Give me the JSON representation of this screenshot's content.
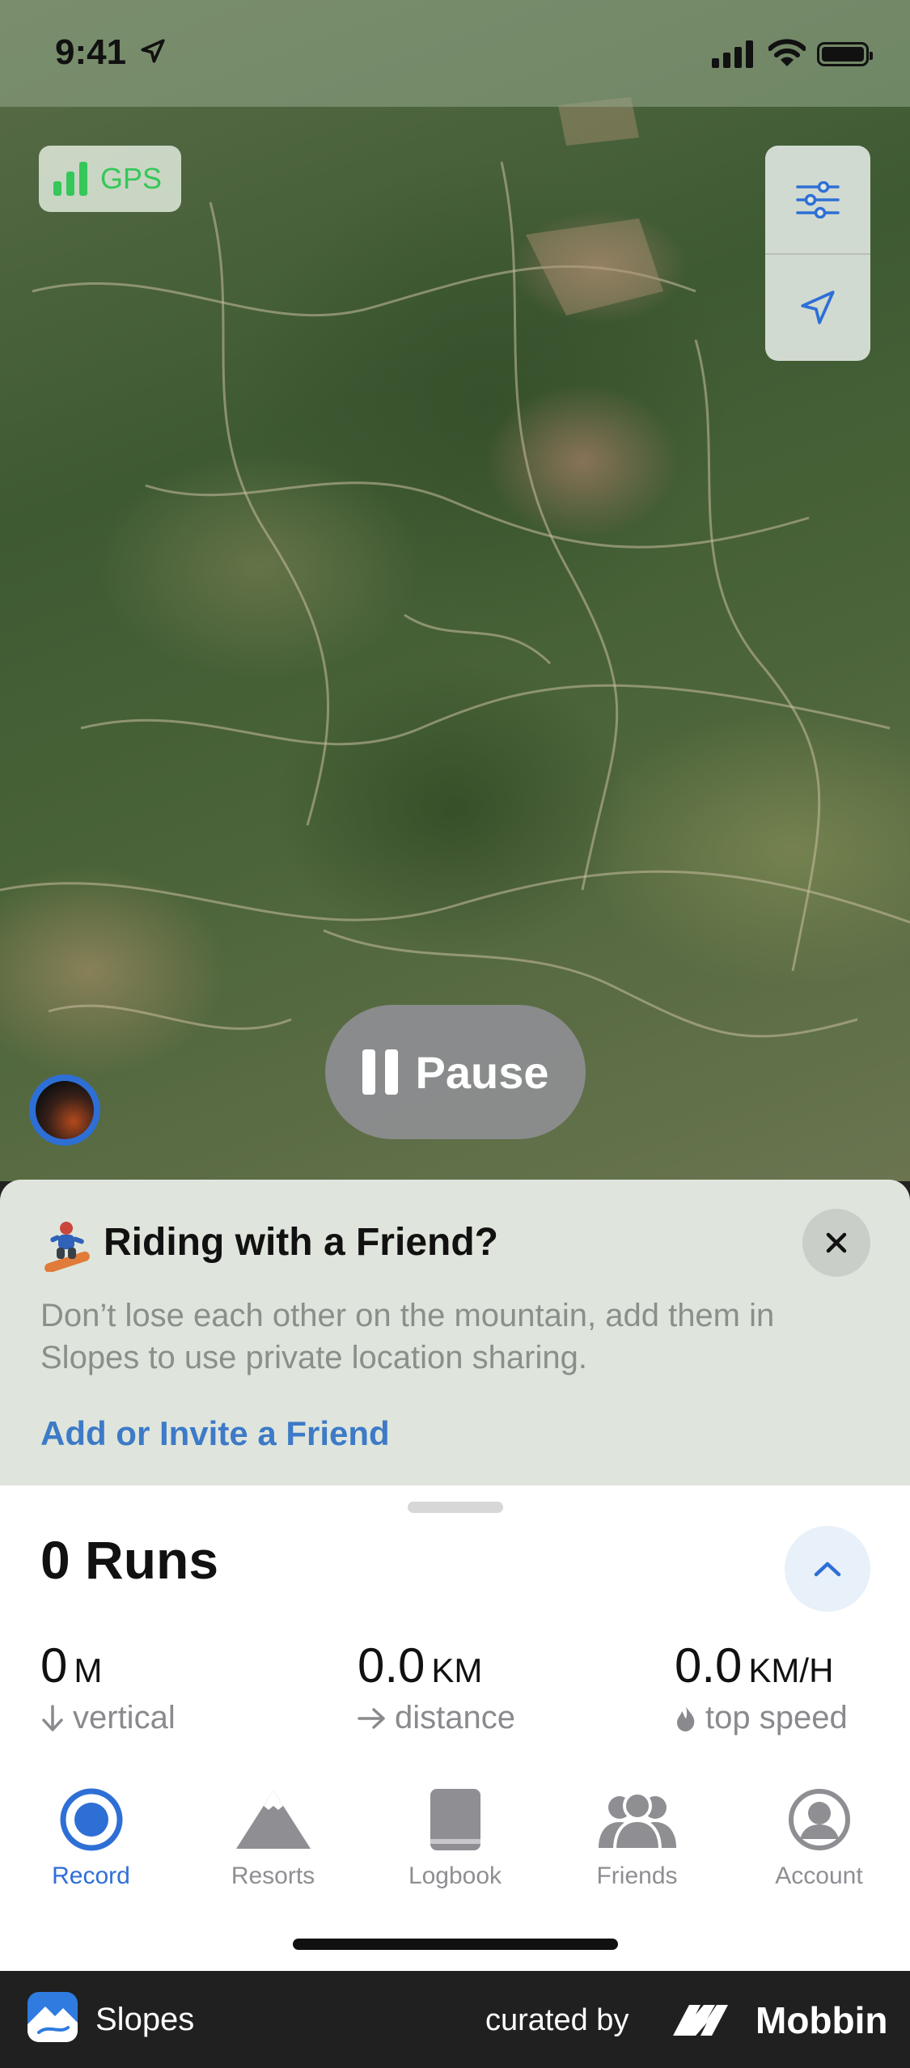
{
  "status_bar": {
    "time": "9:41"
  },
  "map": {
    "gps_label": "GPS",
    "filter_button_icon": "sliders-icon",
    "locate_button_icon": "location-arrow-icon",
    "pause_label": "Pause"
  },
  "banner": {
    "emoji": "snowboarder-icon",
    "title": "Riding with a Friend?",
    "body": "Don’t lose each other on the mountain, add them in Slopes to use private location sharing.",
    "link": "Add or Invite a Friend"
  },
  "summary": {
    "runs": "0 Runs",
    "stats": [
      {
        "value": "0",
        "unit": "M",
        "label": "vertical",
        "icon": "arrow-down-icon"
      },
      {
        "value": "0.0",
        "unit": "KM",
        "label": "distance",
        "icon": "arrow-right-icon"
      },
      {
        "value": "0.0",
        "unit": "KM/H",
        "label": "top speed",
        "icon": "flame-icon"
      }
    ]
  },
  "tabs": [
    {
      "label": "Record",
      "icon": "record-icon",
      "active": true
    },
    {
      "label": "Resorts",
      "icon": "mountain-icon",
      "active": false
    },
    {
      "label": "Logbook",
      "icon": "book-icon",
      "active": false
    },
    {
      "label": "Friends",
      "icon": "friends-icon",
      "active": false
    },
    {
      "label": "Account",
      "icon": "account-icon",
      "active": false
    }
  ],
  "footer": {
    "app_name": "Slopes",
    "curated_by": "curated by",
    "brand": "Mobbin"
  },
  "colors": {
    "accent": "#2e6fd6",
    "link": "#3d7ac7",
    "gps_green": "#35c759"
  }
}
